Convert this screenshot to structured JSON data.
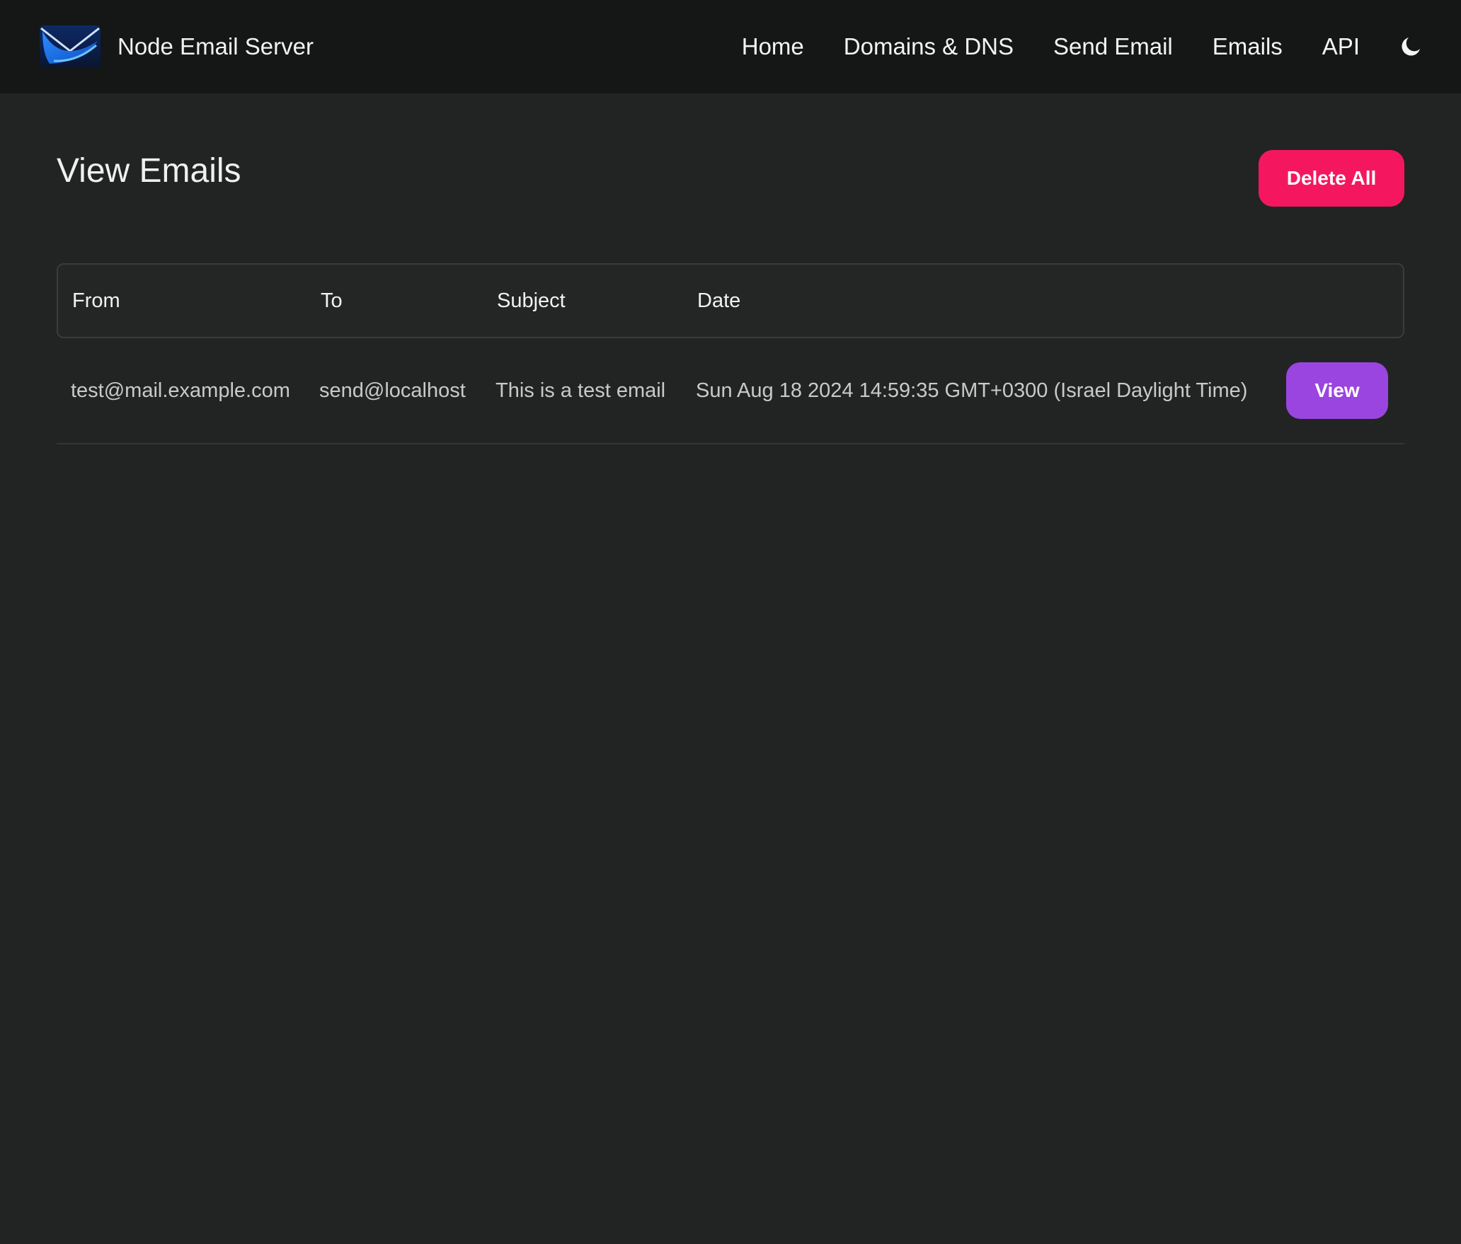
{
  "navbar": {
    "brand": {
      "name": "Node Email Server",
      "logo_icon": "envelope-logo-icon",
      "logo_colors": [
        "#0a3a8f",
        "#1e7ff0",
        "#0b1a40"
      ]
    },
    "links": [
      {
        "label": "Home"
      },
      {
        "label": "Domains & DNS"
      },
      {
        "label": "Send Email"
      },
      {
        "label": "Emails"
      },
      {
        "label": "API"
      }
    ],
    "theme_toggle_icon": "moon-icon",
    "background": "#151616"
  },
  "main": {
    "title": "View Emails",
    "delete_all_label": "Delete All",
    "table": {
      "columns": [
        "From",
        "To",
        "Subject",
        "Date"
      ],
      "rows": [
        {
          "from": "test@mail.example.com",
          "to": "send@localhost",
          "subject": "This is a test email",
          "date": "Sun Aug 18 2024 14:59:35 GMT+0300 (Israel Daylight Time)",
          "action_label": "View"
        }
      ]
    }
  },
  "colors": {
    "page_background": "#222424",
    "delete_button": "#f4175f",
    "view_button": "#9a45e0"
  }
}
